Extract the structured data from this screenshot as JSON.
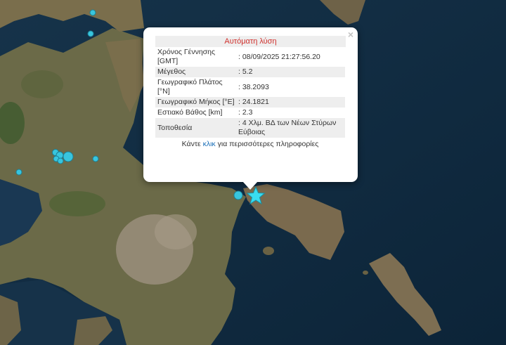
{
  "popup": {
    "title": "Αυτόματη λύση",
    "close": "×",
    "rows": [
      {
        "label": "Χρόνος Γέννησης [GMT]",
        "value": ": 08/09/2025 21:27:56.20"
      },
      {
        "label": "Μέγεθος",
        "value": ": 5.2"
      },
      {
        "label": "Γεωγραφικό Πλάτος [°N]",
        "value": ": 38.2093"
      },
      {
        "label": "Γεωγραφικό Μήκος [°E]",
        "value": ": 24.1821"
      },
      {
        "label": "Εστιακό Βάθος [km]",
        "value": ": 2.3"
      },
      {
        "label": "Τοποθεσία",
        "value": ": 4 Χλμ. ΒΔ των Νέων Στύρων Εύβοιας"
      }
    ],
    "more_prefix": "Κάντε ",
    "more_link": "κλικ",
    "more_suffix": " για περισσότερες πληροφορίες"
  },
  "colors": {
    "marker": "#38c5de",
    "marker_stroke": "#1d7f94",
    "title": "#d0312d",
    "link": "#1a6fb8"
  }
}
